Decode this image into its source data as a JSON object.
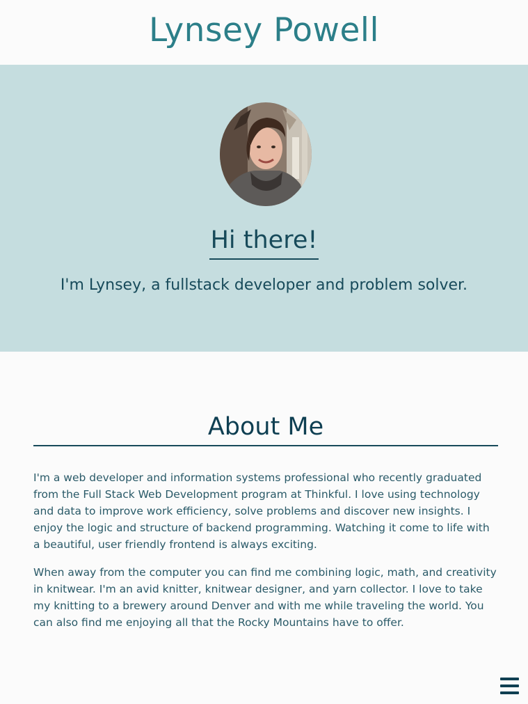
{
  "header": {
    "title": "Lynsey Powell"
  },
  "hero": {
    "avatar_alt": "profile-photo",
    "greeting": "Hi there!",
    "tagline": "I'm Lynsey, a fullstack developer and problem solver."
  },
  "about": {
    "title": "About Me",
    "paragraphs": [
      "I'm a web developer and information systems professional who recently graduated from the Full Stack Web Development program at Thinkful. I love using technology and data to improve work efficiency, solve problems and discover new insights. I enjoy the logic and structure of backend programming. Watching it come to life with a beautiful, user friendly frontend is always exciting.",
      "When away from the computer you can find me combining logic, math, and creativity in knitwear. I'm an avid knitter, knitwear designer, and yarn collector. I love to take my knitting to a brewery around Denver and with me while traveling the world. You can also find me enjoying all that the Rocky Mountains have to offer."
    ]
  },
  "menu": {
    "icon": "hamburger-menu-icon"
  },
  "colors": {
    "header_title": "#2c7f89",
    "hero_background": "#c5dddf",
    "text_dark": "#174a5a",
    "page_background": "#fbfbfb"
  }
}
